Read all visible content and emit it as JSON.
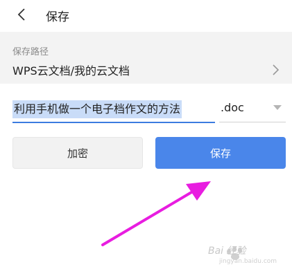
{
  "header": {
    "title": "保存"
  },
  "path": {
    "label": "保存路径",
    "value": "WPS云文档/我的云文档"
  },
  "file": {
    "name": "利用手机做一个电子档作文的方法",
    "extension": ".doc"
  },
  "buttons": {
    "encrypt": "加密",
    "save": "保存"
  },
  "watermark": {
    "brand": "Bai 经验",
    "url": "jingyan.baidu.com"
  },
  "colors": {
    "accent": "#4a86ea",
    "arrow": "#e81de0",
    "selection": "#c9dcf8"
  }
}
